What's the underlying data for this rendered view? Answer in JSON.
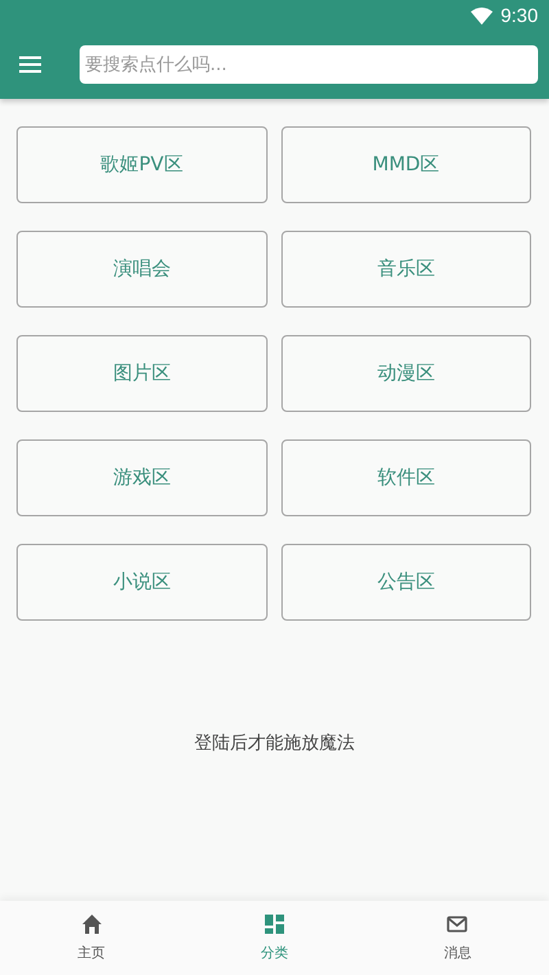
{
  "status_bar": {
    "time": "9:30"
  },
  "search": {
    "placeholder": "要搜索点什么吗..."
  },
  "categories": [
    {
      "label": "歌姬PV区"
    },
    {
      "label": "MMD区"
    },
    {
      "label": "演唱会"
    },
    {
      "label": "音乐区"
    },
    {
      "label": "图片区"
    },
    {
      "label": "动漫区"
    },
    {
      "label": "游戏区"
    },
    {
      "label": "软件区"
    },
    {
      "label": "小说区"
    },
    {
      "label": "公告区"
    }
  ],
  "notice": "登陆后才能施放魔法",
  "bottom_nav": [
    {
      "label": "主页",
      "kind": "home",
      "selected": false
    },
    {
      "label": "分类",
      "kind": "category",
      "selected": true
    },
    {
      "label": "消息",
      "kind": "mail",
      "selected": false
    }
  ]
}
